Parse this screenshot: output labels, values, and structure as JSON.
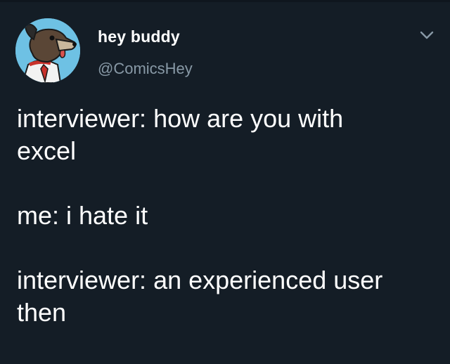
{
  "tweet": {
    "display_name": "hey buddy",
    "handle": "@ComicsHey",
    "avatar_icon": "cartoon-dog-avatar",
    "menu_icon": "chevron-down-icon",
    "paragraphs": [
      "interviewer: how are you with\nexcel",
      "me: i hate it",
      "interviewer: an experienced user\nthen"
    ]
  },
  "colors": {
    "background": "#141d26",
    "text": "#ffffff",
    "secondary_text": "#8899a6",
    "avatar_bg": "#6ec1e4"
  }
}
